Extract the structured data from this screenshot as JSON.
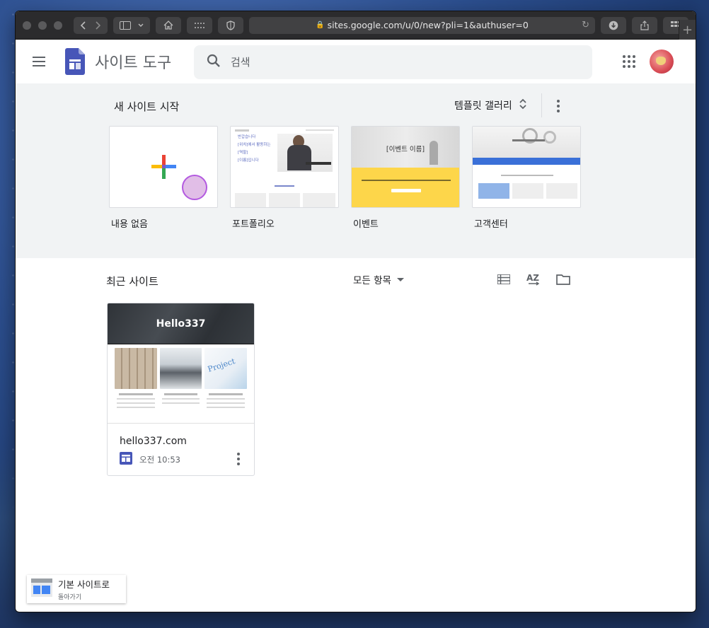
{
  "browser": {
    "url": "sites.google.com/u/0/new?pli=1&authuser=0"
  },
  "header": {
    "app_title": "사이트 도구",
    "search_placeholder": "검색"
  },
  "templates": {
    "section_title": "새 사이트 시작",
    "gallery_label": "템플릿 갤러리",
    "items": [
      {
        "label": "내용 없음"
      },
      {
        "label": "포트폴리오"
      },
      {
        "label": "이벤트"
      },
      {
        "label": "고객센터"
      }
    ],
    "portfolio_thumb": {
      "lines": [
        "반갑습니다",
        "[위치]에서 활동하는",
        "[역할]",
        "[이름]입니다"
      ]
    },
    "event_thumb": {
      "title": "[이벤트 이름]"
    }
  },
  "recent": {
    "title": "최근 사이트",
    "owner_filter": "모든 항목",
    "sites": [
      {
        "banner_title": "Hello337",
        "name": "hello337.com",
        "time": "오전 10:53"
      }
    ]
  },
  "back_classic": {
    "line1": "기본 사이트로",
    "line2": "돌아가기"
  },
  "colors": {
    "sites_blue": "#4756b8",
    "google_blue": "#4285f4",
    "google_red": "#ea4335",
    "google_yellow": "#fbbc04",
    "google_green": "#34a853",
    "template_bg": "#f1f3f4"
  }
}
